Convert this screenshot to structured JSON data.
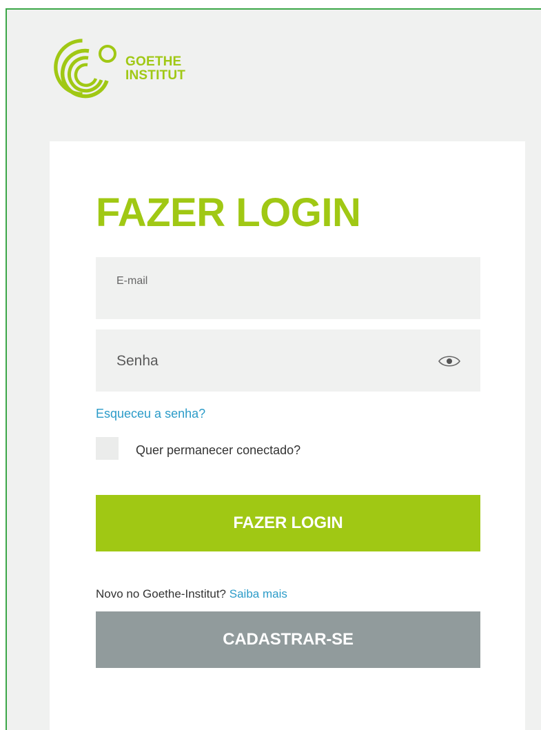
{
  "brand": {
    "line1": "GOETHE",
    "line2": "INSTITUT",
    "color": "#a0c814"
  },
  "login": {
    "title": "FAZER LOGIN",
    "email_label": "E-mail",
    "email_value": "",
    "password_label": "Senha",
    "password_value": "",
    "show_password_icon": "eye-icon",
    "forgot_link": "Esqueceu a senha?",
    "remember_label": "Quer permanecer conectado?",
    "remember_checked": false,
    "submit_label": "FAZER LOGIN"
  },
  "register": {
    "prompt": "Novo no Goethe-Institut?",
    "learn_more_link": "Saiba mais",
    "button_label": "CADASTRAR-SE"
  },
  "colors": {
    "accent": "#a0c814",
    "link": "#2b9bc8",
    "secondary_button": "#919b9c",
    "frame_border": "#3aa647"
  }
}
